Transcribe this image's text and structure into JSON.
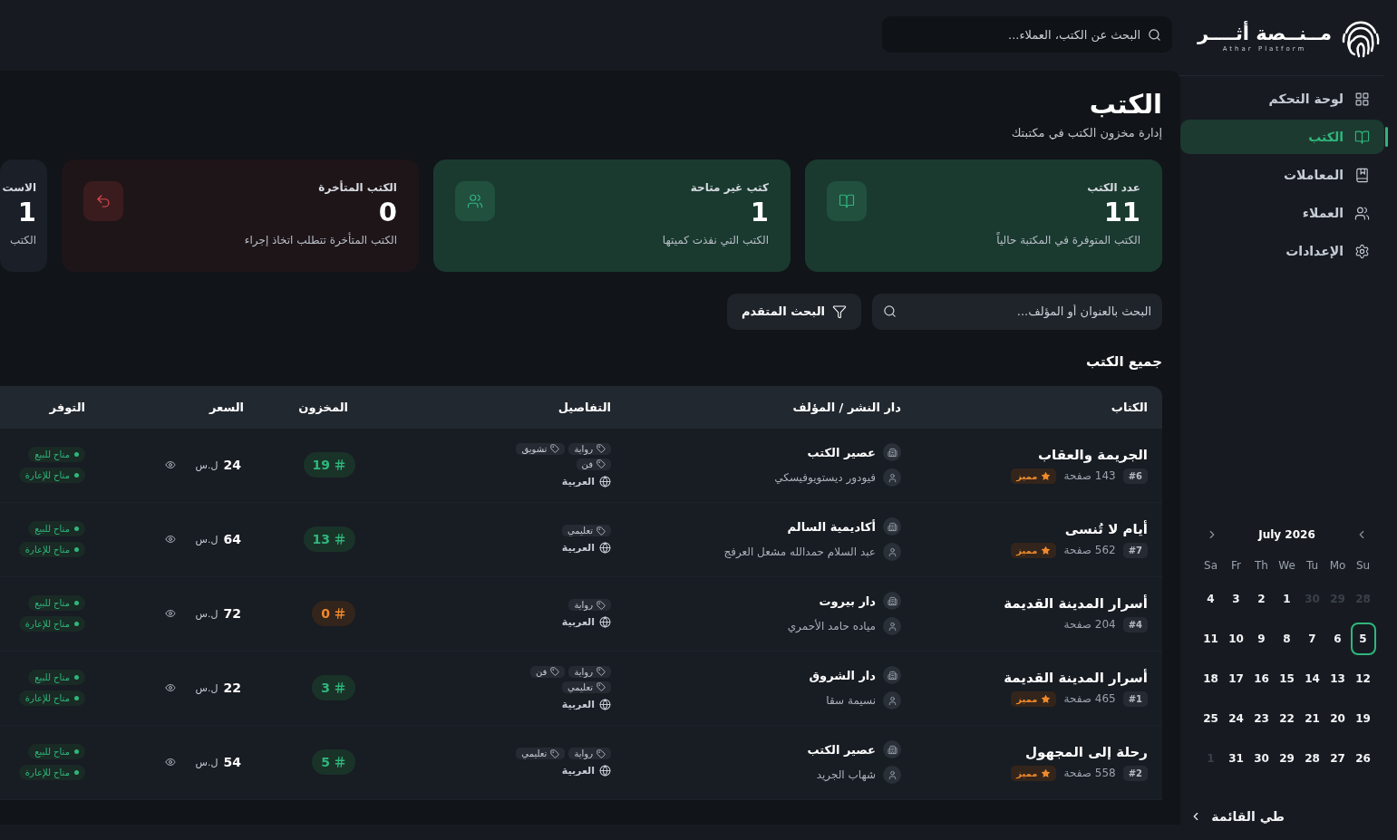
{
  "sidebar": {
    "logo": {
      "name": "مــنــصة أثــــر",
      "subtitle": "Athar Platform"
    },
    "items": [
      {
        "label": "لوحة التحكم",
        "selected": false
      },
      {
        "label": "الكتب",
        "selected": true
      },
      {
        "label": "المعاملات",
        "selected": false
      },
      {
        "label": "العملاء",
        "selected": false
      },
      {
        "label": "الإعدادات",
        "selected": false
      }
    ],
    "calendar": {
      "month": "July 2026",
      "weekdays": [
        "Su",
        "Mo",
        "Tu",
        "We",
        "Th",
        "Fr",
        "Sa"
      ],
      "days": [
        {
          "d": "28",
          "outside": true,
          "selected": false
        },
        {
          "d": "29",
          "outside": true,
          "selected": false
        },
        {
          "d": "30",
          "outside": true,
          "selected": false
        },
        {
          "d": "1",
          "outside": false,
          "selected": false
        },
        {
          "d": "2",
          "outside": false,
          "selected": false
        },
        {
          "d": "3",
          "outside": false,
          "selected": false
        },
        {
          "d": "4",
          "outside": false,
          "selected": false
        },
        {
          "d": "5",
          "outside": false,
          "selected": true
        },
        {
          "d": "6",
          "outside": false,
          "selected": false
        },
        {
          "d": "7",
          "outside": false,
          "selected": false
        },
        {
          "d": "8",
          "outside": false,
          "selected": false
        },
        {
          "d": "9",
          "outside": false,
          "selected": false
        },
        {
          "d": "10",
          "outside": false,
          "selected": false
        },
        {
          "d": "11",
          "outside": false,
          "selected": false
        },
        {
          "d": "12",
          "outside": false,
          "selected": false
        },
        {
          "d": "13",
          "outside": false,
          "selected": false
        },
        {
          "d": "14",
          "outside": false,
          "selected": false
        },
        {
          "d": "15",
          "outside": false,
          "selected": false
        },
        {
          "d": "16",
          "outside": false,
          "selected": false
        },
        {
          "d": "17",
          "outside": false,
          "selected": false
        },
        {
          "d": "18",
          "outside": false,
          "selected": false
        },
        {
          "d": "19",
          "outside": false,
          "selected": false
        },
        {
          "d": "20",
          "outside": false,
          "selected": false
        },
        {
          "d": "21",
          "outside": false,
          "selected": false
        },
        {
          "d": "22",
          "outside": false,
          "selected": false
        },
        {
          "d": "23",
          "outside": false,
          "selected": false
        },
        {
          "d": "24",
          "outside": false,
          "selected": false
        },
        {
          "d": "25",
          "outside": false,
          "selected": false
        },
        {
          "d": "26",
          "outside": false,
          "selected": false
        },
        {
          "d": "27",
          "outside": false,
          "selected": false
        },
        {
          "d": "28",
          "outside": false,
          "selected": false
        },
        {
          "d": "29",
          "outside": false,
          "selected": false
        },
        {
          "d": "30",
          "outside": false,
          "selected": false
        },
        {
          "d": "31",
          "outside": false,
          "selected": false
        },
        {
          "d": "1",
          "outside": true,
          "selected": false
        }
      ]
    },
    "collapse": "طي القائمة"
  },
  "header": {
    "search": {
      "placeholder": "البحث عن الكتب، العملاء..."
    }
  },
  "page": {
    "title": "الكتب",
    "subtitle": "إدارة مخزون الكتب في مكتبتك"
  },
  "stats": [
    {
      "kind": "success",
      "label": "عدد الكتب",
      "value": "11",
      "note": "الكتب المتوفرة في المكتبة حالياً"
    },
    {
      "kind": "success",
      "label": "كتب غير متاحة",
      "value": "1",
      "note": "الكتب التي نفذت كميتها"
    },
    {
      "kind": "danger",
      "label": "الكتب المتأخرة",
      "value": "0",
      "note": "الكتب المتأخرة تتطلب اتخاذ إجراء"
    },
    {
      "kind": "neutral",
      "label": "الاست",
      "value": "1",
      "note": "الكتب"
    }
  ],
  "filters": {
    "search": {
      "placeholder": "البحث بالعنوان أو المؤلف..."
    },
    "advanced": "البحث المتقدم"
  },
  "table": {
    "title": "جميع الكتب",
    "columns": [
      "الكتاب",
      "دار النشر / المؤلف",
      "التفاصيل",
      "المخزون",
      "السعر",
      "التوفر"
    ],
    "rows": [
      {
        "title": "الجريمة والعقاب",
        "id": "#6",
        "pages": "143 صفحة",
        "featured": true,
        "badge": "مميز",
        "publisher": "عصير الكتب",
        "author": "فيودور ديستويوفيسكي",
        "tags": [
          "رواية",
          "تشويق",
          "فن"
        ],
        "language": "العربية",
        "stock": "19",
        "in_stock": true,
        "price": "24",
        "currency": "ل.س",
        "availability": [
          "متاح للبيع",
          "متاح للإعارة"
        ]
      },
      {
        "title": "أيام لا تُنسى",
        "id": "#7",
        "pages": "562 صفحة",
        "featured": true,
        "badge": "مميز",
        "publisher": "أكاديمية السالم",
        "author": "عبد السلام حمدالله مشعل العرفج",
        "tags": [
          "تعليمي"
        ],
        "language": "العربية",
        "stock": "13",
        "in_stock": true,
        "price": "64",
        "currency": "ل.س",
        "availability": [
          "متاح للبيع",
          "متاح للإعارة"
        ]
      },
      {
        "title": "أسرار المدينة القديمة",
        "id": "#4",
        "pages": "204 صفحة",
        "featured": false,
        "publisher": "دار بيروت",
        "author": "مياده حامد الأحمري",
        "tags": [
          "رواية"
        ],
        "language": "العربية",
        "stock": "0",
        "in_stock": false,
        "price": "72",
        "currency": "ل.س",
        "availability": [
          "متاح للبيع",
          "متاح للإعارة"
        ]
      },
      {
        "title": "أسرار المدينة القديمة",
        "id": "#1",
        "pages": "465 صفحة",
        "featured": true,
        "badge": "مميز",
        "publisher": "دار الشروق",
        "author": "نسيمة سقا",
        "tags": [
          "رواية",
          "فن",
          "تعليمي"
        ],
        "language": "العربية",
        "stock": "3",
        "in_stock": true,
        "price": "22",
        "currency": "ل.س",
        "availability": [
          "متاح للبيع",
          "متاح للإعارة"
        ]
      },
      {
        "title": "رحلة إلى المجهول",
        "id": "#2",
        "pages": "558 صفحة",
        "featured": true,
        "badge": "مميز",
        "publisher": "عصير الكتب",
        "author": "شهاب الجريد",
        "tags": [
          "رواية",
          "تعليمي"
        ],
        "language": "العربية",
        "stock": "5",
        "in_stock": true,
        "price": "54",
        "currency": "ل.س",
        "availability": [
          "متاح للبيع",
          "متاح للإعارة"
        ]
      }
    ]
  }
}
